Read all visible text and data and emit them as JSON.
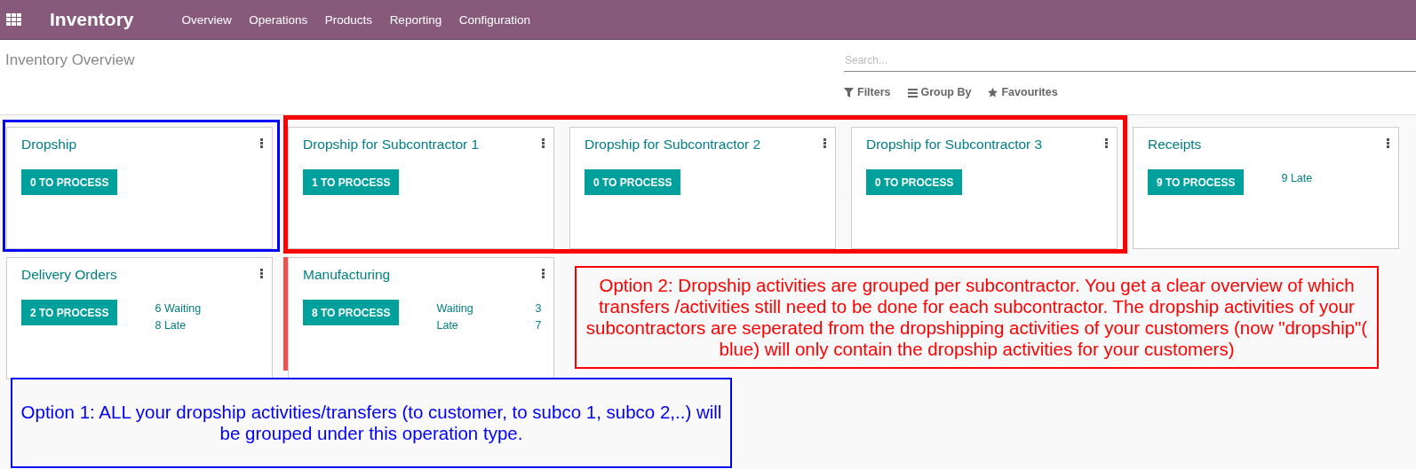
{
  "navbar": {
    "app_title": "Inventory",
    "menu": [
      {
        "label": "Overview"
      },
      {
        "label": "Operations"
      },
      {
        "label": "Products"
      },
      {
        "label": "Reporting"
      },
      {
        "label": "Configuration"
      }
    ]
  },
  "control_panel": {
    "title": "Inventory Overview",
    "search": {
      "placeholder": "Search..."
    },
    "options": [
      {
        "kind": "filter",
        "label": "Filters"
      },
      {
        "kind": "groupby",
        "label": "Group By"
      },
      {
        "kind": "favourites",
        "label": "Favourites"
      }
    ]
  },
  "cards": [
    {
      "title": "Dropship",
      "button": "0 TO PROCESS"
    },
    {
      "title": "Dropship for Subcontractor 1",
      "button": "1 TO PROCESS"
    },
    {
      "title": "Dropship for Subcontractor 2",
      "button": "0 TO PROCESS"
    },
    {
      "title": "Dropship for Subcontractor 3",
      "button": "0 TO PROCESS"
    },
    {
      "title": "Receipts",
      "button": "9 TO PROCESS",
      "stats": [
        {
          "label": "9 Late"
        }
      ]
    },
    {
      "title": "Delivery Orders",
      "button": "2 TO PROCESS",
      "stats": [
        {
          "label": "6 Waiting"
        },
        {
          "label": "8 Late"
        }
      ]
    },
    {
      "title": "Manufacturing",
      "button": "8 TO PROCESS",
      "stats": [
        {
          "label": "Waiting",
          "value": "3"
        },
        {
          "label": "Late",
          "value": "7"
        }
      ]
    }
  ],
  "annotations": [
    {
      "kind": "frame",
      "color": "#0000ff"
    },
    {
      "kind": "frame",
      "color": "#ff0000"
    },
    {
      "kind": "line",
      "color": "#ef5350"
    },
    {
      "kind": "note",
      "color": "#ff0000",
      "text": "Option 2: Dropship activities are grouped per subcontractor. You get a clear overview of which transfers /activities still need to be done for each subcontractor. The dropship activities of your subcontractors are seperated from the dropshipping activities of your customers (now \"dropship\"( blue) will only contain the dropship activities for your customers)"
    },
    {
      "kind": "note",
      "color": "#0000ff",
      "text": "Option 1: ALL your dropship activities/transfers (to customer, to subco 1, subco 2,..) will be grouped under this operation type."
    }
  ]
}
